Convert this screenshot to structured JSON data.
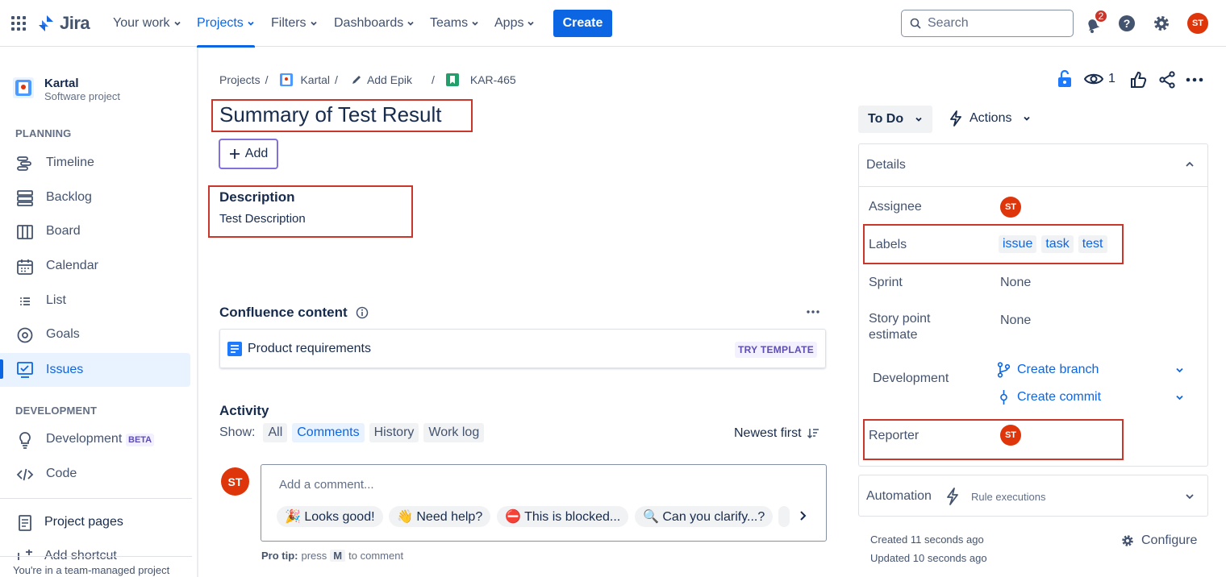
{
  "topnav": {
    "logo": "Jira",
    "items": [
      {
        "label": "Your work"
      },
      {
        "label": "Projects"
      },
      {
        "label": "Filters"
      },
      {
        "label": "Dashboards"
      },
      {
        "label": "Teams"
      },
      {
        "label": "Apps"
      }
    ],
    "create_label": "Create",
    "search_placeholder": "Search",
    "notification_count": "2",
    "avatar_initials": "ST",
    "brand_color": "#0C66E4"
  },
  "sidebar": {
    "project_name": "Kartal",
    "project_type": "Software project",
    "planning_heading": "PLANNING",
    "planning_items": [
      {
        "label": "Timeline",
        "icon": "timeline-icon"
      },
      {
        "label": "Backlog",
        "icon": "backlog-icon"
      },
      {
        "label": "Board",
        "icon": "board-icon"
      },
      {
        "label": "Calendar",
        "icon": "calendar-icon"
      },
      {
        "label": "List",
        "icon": "list-icon"
      },
      {
        "label": "Goals",
        "icon": "goals-icon"
      },
      {
        "label": "Issues",
        "icon": "issues-icon"
      }
    ],
    "development_heading": "DEVELOPMENT",
    "development_items": [
      {
        "label": "Development",
        "badge": "BETA",
        "icon": "lightbulb-icon"
      },
      {
        "label": "Code",
        "icon": "code-icon"
      }
    ],
    "project_pages": "Project pages",
    "add_shortcut": "Add shortcut",
    "footer": "You're in a team-managed project"
  },
  "breadcrumb": {
    "projects": "Projects",
    "project": "Kartal",
    "epic": "Add Epik",
    "issue_key": "KAR-465"
  },
  "issue": {
    "title": "Summary of Test Result",
    "add_label": "Add",
    "description_heading": "Description",
    "description_text": "Test Description",
    "watchers_count": "1"
  },
  "confluence": {
    "heading": "Confluence content",
    "item": "Product requirements",
    "try_template": "TRY TEMPLATE"
  },
  "activity": {
    "heading": "Activity",
    "show_label": "Show:",
    "filters": [
      "All",
      "Comments",
      "History",
      "Work log"
    ],
    "selected_filter": "Comments",
    "sort": "Newest first",
    "comment_placeholder": "Add a comment...",
    "quick_replies": [
      "🎉 Looks good!",
      "👋 Need help?",
      "⛔ This is blocked...",
      "🔍 Can you clarify...?"
    ],
    "pro_tip_bold": "Pro tip:",
    "pro_tip_pre": "press",
    "pro_tip_key": "M",
    "pro_tip_post": "to comment",
    "avatar_initials": "ST"
  },
  "status": {
    "current": "To Do",
    "actions": "Actions"
  },
  "details": {
    "heading": "Details",
    "assignee_label": "Assignee",
    "assignee_initials": "ST",
    "labels_label": "Labels",
    "labels": [
      "issue",
      "task",
      "test"
    ],
    "sprint_label": "Sprint",
    "sprint_value": "None",
    "story_point_label_1": "Story point",
    "story_point_label_2": "estimate",
    "story_point_value": "None",
    "development_label": "Development",
    "create_branch": "Create branch",
    "create_commit": "Create commit",
    "reporter_label": "Reporter",
    "reporter_initials": "ST"
  },
  "automation": {
    "heading": "Automation",
    "rule_executions": "Rule executions"
  },
  "footer_meta": {
    "created": "Created 11 seconds ago",
    "updated": "Updated 10 seconds ago",
    "configure": "Configure"
  }
}
